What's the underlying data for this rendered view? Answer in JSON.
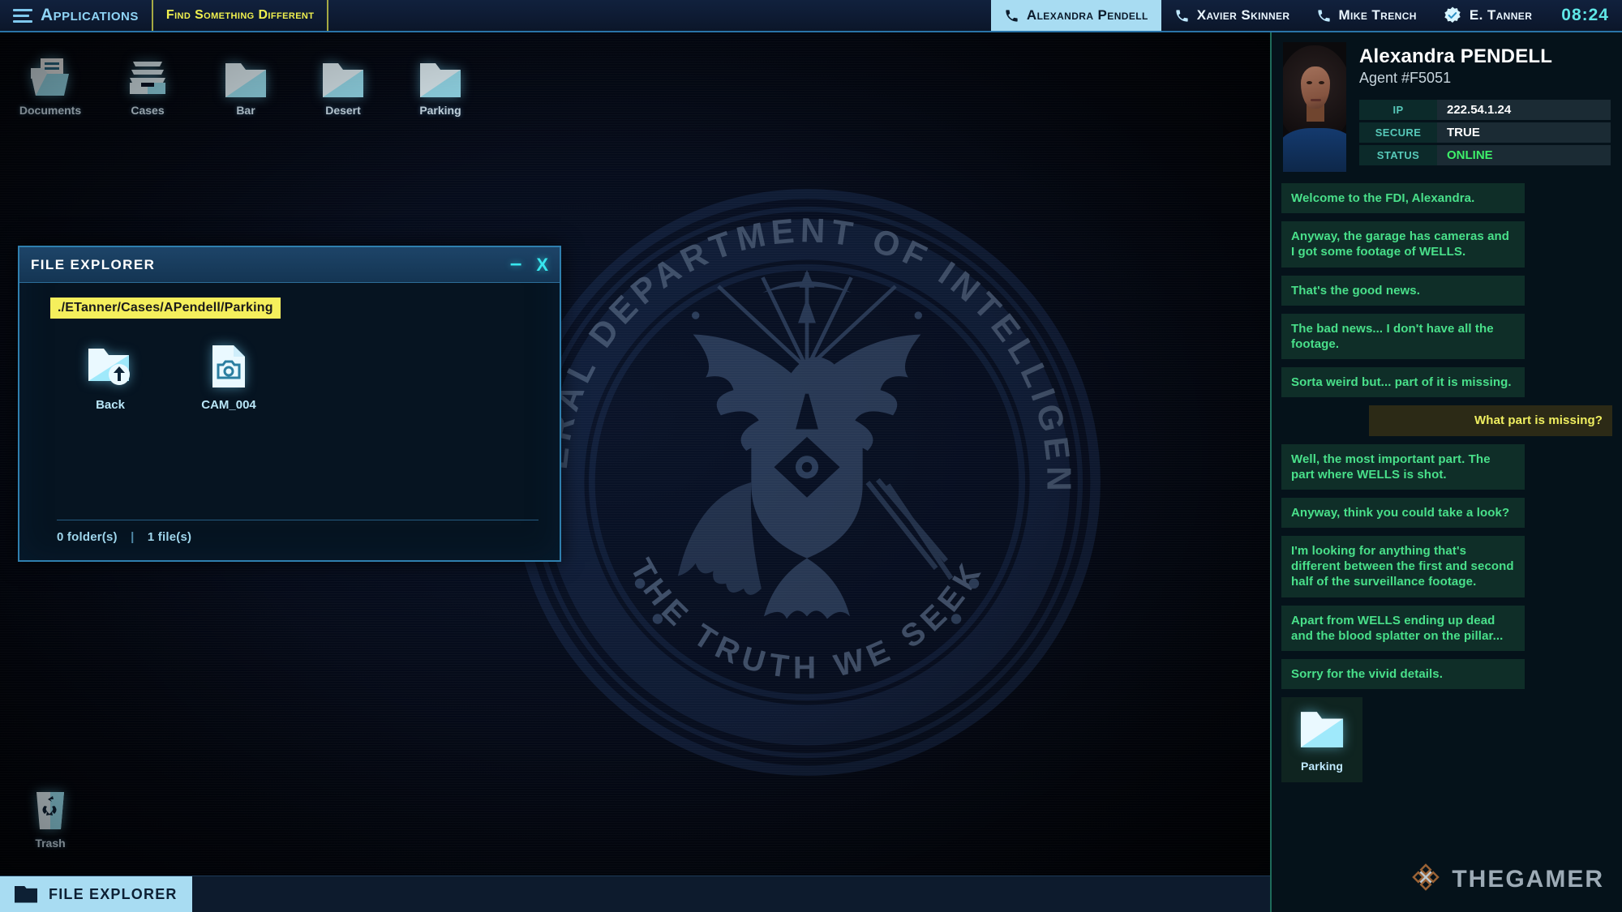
{
  "topbar": {
    "menu_icon": "hamburger-icon",
    "apps_label": "Applications",
    "objective": "Find something different",
    "contacts": [
      {
        "name": "Alexandra Pendell",
        "icon": "phone-icon",
        "active": true
      },
      {
        "name": "Xavier Skinner",
        "icon": "phone-icon",
        "active": false
      },
      {
        "name": "Mike Trench",
        "icon": "phone-icon",
        "active": false
      },
      {
        "name": "E. Tanner",
        "icon": "verified-badge-icon",
        "active": false
      }
    ],
    "clock": "08:24"
  },
  "desktop": {
    "icons": [
      {
        "label": "Documents",
        "icon": "documents-folder-icon"
      },
      {
        "label": "Cases",
        "icon": "cases-tray-icon"
      },
      {
        "label": "Bar",
        "icon": "folder-icon"
      },
      {
        "label": "Desert",
        "icon": "folder-icon"
      },
      {
        "label": "Parking",
        "icon": "folder-icon"
      }
    ],
    "trash": {
      "label": "Trash",
      "icon": "recycle-bin-icon"
    },
    "seal": {
      "top_text": "FEDERAL DEPARTMENT OF INTELLIGENCE",
      "bottom_text": "THE TRUTH WE SEEK"
    }
  },
  "file_explorer": {
    "title": "FILE EXPLORER",
    "minimize_label": "–",
    "close_label": "X",
    "path": "./ETanner/Cases/APendell/Parking",
    "items": [
      {
        "label": "Back",
        "icon": "folder-up-icon"
      },
      {
        "label": "CAM_004",
        "icon": "camera-file-icon"
      }
    ],
    "status_folders": "0 folder(s)",
    "status_sep": "|",
    "status_files": "1 file(s)"
  },
  "taskbar": {
    "items": [
      {
        "label": "FILE EXPLORER",
        "icon": "folder-icon"
      }
    ]
  },
  "sidebar": {
    "profile": {
      "first_name": "Alexandra",
      "last_name": "PENDELL",
      "agent_id": "Agent #F5051",
      "avatar": "agent-portrait",
      "fields": [
        {
          "key": "IP",
          "value": "222.54.1.24",
          "status": false
        },
        {
          "key": "SECURE",
          "value": "TRUE",
          "status": false
        },
        {
          "key": "STATUS",
          "value": "ONLINE",
          "status": true
        }
      ]
    },
    "messages": [
      {
        "from": "them",
        "text": "Welcome to the FDI, Alexandra."
      },
      {
        "from": "them",
        "text": "Anyway, the garage has cameras and I got some footage of WELLS."
      },
      {
        "from": "them",
        "text": "That's the good news."
      },
      {
        "from": "them",
        "text": "The bad news... I don't have all the footage."
      },
      {
        "from": "them",
        "text": "Sorta weird but... part of it is missing."
      },
      {
        "from": "me",
        "text": "What part is missing?"
      },
      {
        "from": "them",
        "text": "Well, the most important part. The part where WELLS is shot."
      },
      {
        "from": "them",
        "text": "Anyway, think you could take a look?"
      },
      {
        "from": "them",
        "text": "I'm looking for anything that's different between the first and second half of the surveillance footage."
      },
      {
        "from": "them",
        "text": "Apart from WELLS ending up dead and the blood splatter on the pillar..."
      },
      {
        "from": "them",
        "text": "Sorry for the vivid details."
      }
    ],
    "attachment": {
      "label": "Parking",
      "icon": "folder-icon"
    }
  },
  "watermark": {
    "text": "THEGAMER",
    "icon": "thegamer-logo-icon"
  },
  "colors": {
    "accent_cyan": "#8fd4f5",
    "objective_yellow": "#f0f04f",
    "chat_green": "#49e08a",
    "status_online": "#3ef06a",
    "window_border": "#2f7fae",
    "path_highlight": "#f5ef5c"
  }
}
